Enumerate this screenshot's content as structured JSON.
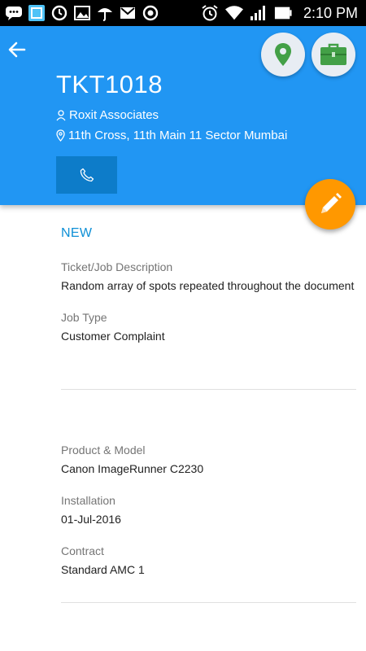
{
  "status_bar": {
    "time": "2:10 PM",
    "left_icons": [
      "chat-bubble-icon",
      "tablet-app-icon",
      "sync-icon",
      "image-icon",
      "umbrella-icon",
      "gmail-icon",
      "record-icon"
    ],
    "right_icons": [
      "alarm-icon",
      "wifi-icon",
      "signal-icon",
      "battery-icon"
    ]
  },
  "header": {
    "background": "#2196f3",
    "ticket_id": "TKT1018",
    "customer": "Roxit Associates",
    "address": "11th Cross, 11th Main 11 Sector Mumbai"
  },
  "colors": {
    "primary": "#2196f3",
    "call_button": "#0d7cc9",
    "fab": "#ff9800",
    "location_pin": "#43a047",
    "briefcase": "#43a047",
    "status": "#0d8fd6"
  },
  "details": {
    "status": "NEW",
    "description_label": "Ticket/Job Description",
    "description_value": "Random array of spots repeated throughout the document",
    "job_type_label": "Job Type",
    "job_type_value": "Customer Complaint"
  },
  "product": {
    "product_label": "Product & Model",
    "product_value": "Canon ImageRunner C2230",
    "installation_label": "Installation",
    "installation_value": "01-Jul-2016",
    "contract_label": "Contract",
    "contract_value": "Standard AMC 1"
  }
}
